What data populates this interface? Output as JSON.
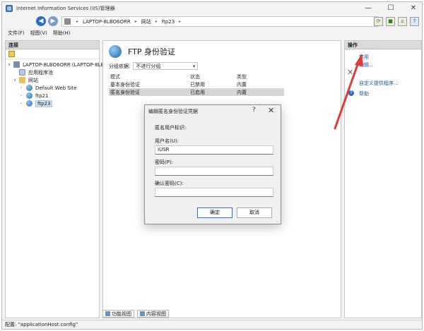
{
  "window": {
    "title": "Internet Information Services (IIS)管理器",
    "controls": {
      "minimize": "—",
      "maximize": "☐",
      "close": "✕"
    }
  },
  "address_bar": {
    "back_glyph": "◀",
    "forward_glyph": "▶",
    "crumbs": [
      "LAPTOP-8LBO6ORR",
      "网站",
      "ftp23"
    ],
    "crumb_separator": "▸",
    "right_icons": [
      "refresh-icon",
      "stop-icon",
      "home-icon",
      "help-icon"
    ],
    "right_glyphs": [
      "⟳",
      "■",
      "⌂",
      "?"
    ]
  },
  "menu": {
    "items": [
      "文件(F)",
      "视图(V)",
      "帮助(H)"
    ]
  },
  "connections": {
    "header": "连接",
    "tree": [
      {
        "label": "LAPTOP-8LBO6ORR (LAPTOP-8LB",
        "twisty": "∨",
        "icon": "server-icon"
      },
      {
        "label": "应用程序池",
        "twisty": "",
        "icon": "app-pool-icon"
      },
      {
        "label": "网站",
        "twisty": "∨",
        "icon": "sites-folder-icon"
      },
      {
        "label": "Default Web Site",
        "twisty": "›",
        "icon": "site-globe-icon"
      },
      {
        "label": "ftp21",
        "twisty": "›",
        "icon": "site-globe-icon"
      },
      {
        "label": "ftp23",
        "twisty": "›",
        "icon": "site-globe-icon",
        "selected": true
      }
    ]
  },
  "main": {
    "title": "FTP 身份验证",
    "group_label": "分组依据:",
    "group_value": "不进行分组",
    "columns": [
      "模式",
      "状态",
      "类型"
    ],
    "rows": [
      {
        "mode": "基本身份验证",
        "status": "已禁用",
        "type": "内置"
      },
      {
        "mode": "匿名身份验证",
        "status": "已启用",
        "type": "内置"
      }
    ],
    "bottom_tabs": [
      "功能视图",
      "内容视图"
    ]
  },
  "actions": {
    "header": "操作",
    "items": [
      "禁用",
      "编辑...",
      "自定义提供程序...",
      "帮助"
    ]
  },
  "status_bar": {
    "text": "配置: \"applicationHost.config\""
  },
  "dialog": {
    "title": "编辑匿名身份验证凭据",
    "help_glyph": "?",
    "close_glyph": "✕",
    "section_label": "匿名用户标识:",
    "username_label": "用户名(U):",
    "username_value": "IUSR",
    "password_label": "密码(P):",
    "password_value": "",
    "confirm_label": "确认密码(C):",
    "confirm_value": "",
    "ok_label": "确定",
    "cancel_label": "取消"
  },
  "colors": {
    "accent": "#2e6cc4",
    "link": "#1c55a8",
    "annotation_arrow": "#e03a3a"
  }
}
